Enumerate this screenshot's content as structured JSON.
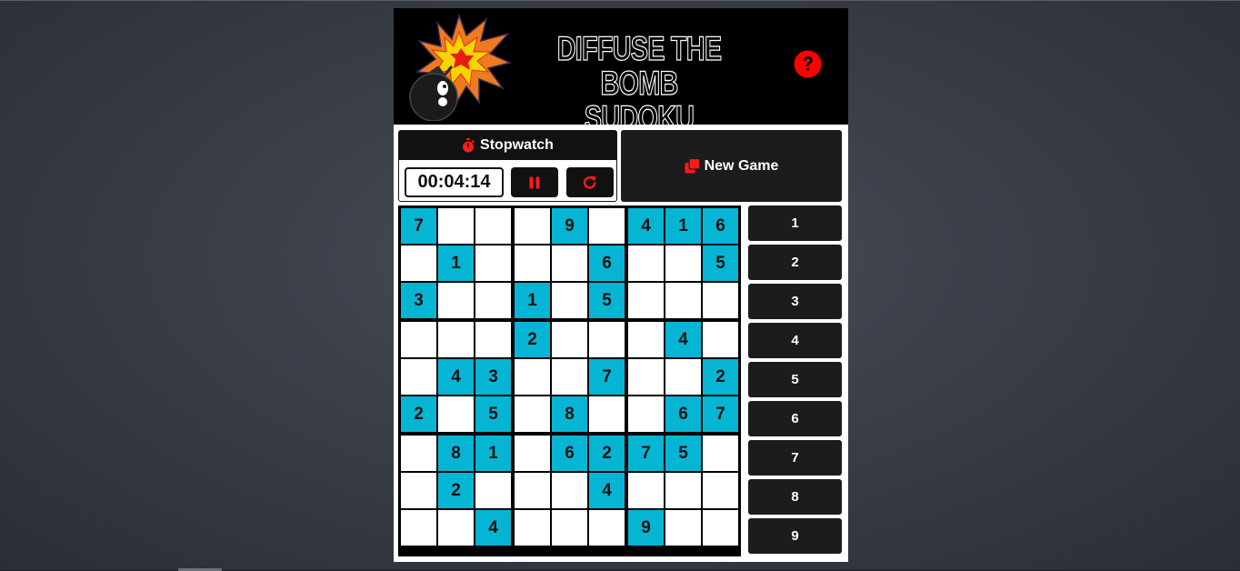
{
  "header": {
    "title_line1": "DIFFUSE THE BOMB",
    "title_line2": "SUDOKU STYLE!",
    "logo_icon": "bomb-explosion-icon",
    "help_icon": "question-circle-icon",
    "help_color": "#ff0000"
  },
  "stopwatch": {
    "label": "Stopwatch",
    "icon": "stopwatch-icon",
    "time": "00:04:14",
    "pause_icon": "pause-icon",
    "reset_icon": "redo-icon",
    "accent": "#ff1a1a"
  },
  "new_game": {
    "label": "New Game",
    "icon": "clone-icon"
  },
  "board": {
    "given_color": "#06b5d4",
    "rows": [
      [
        "7",
        "",
        "",
        "",
        "9",
        "",
        "4",
        "1",
        "6"
      ],
      [
        "",
        "1",
        "",
        "",
        "",
        "6",
        "",
        "",
        "5"
      ],
      [
        "3",
        "",
        "",
        "1",
        "",
        "5",
        "",
        "",
        ""
      ],
      [
        "",
        "",
        "",
        "2",
        "",
        "",
        "",
        "4",
        ""
      ],
      [
        "",
        "4",
        "3",
        "",
        "",
        "7",
        "",
        "",
        "2"
      ],
      [
        "2",
        "",
        "5",
        "",
        "8",
        "",
        "",
        "6",
        "7"
      ],
      [
        "",
        "8",
        "1",
        "",
        "6",
        "2",
        "7",
        "5",
        ""
      ],
      [
        "",
        "2",
        "",
        "",
        "",
        "4",
        "",
        "",
        ""
      ],
      [
        "",
        "",
        "4",
        "",
        "",
        "",
        "9",
        "",
        ""
      ]
    ]
  },
  "numpad": {
    "buttons": [
      "1",
      "2",
      "3",
      "4",
      "5",
      "6",
      "7",
      "8",
      "9"
    ]
  }
}
